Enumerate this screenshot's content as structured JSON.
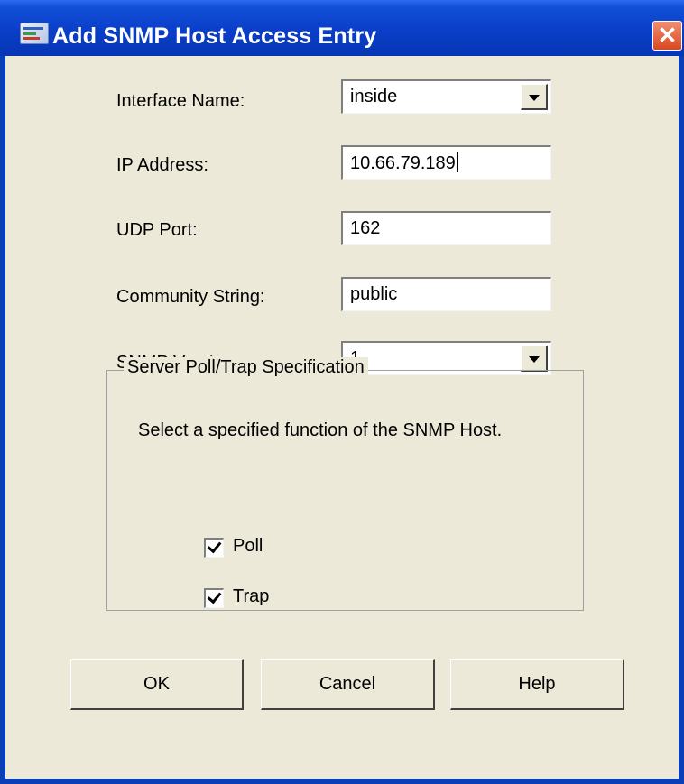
{
  "window": {
    "title": "Add SNMP Host Access Entry",
    "close_glyph": "✕",
    "icon": "app-icon"
  },
  "form": {
    "interface_name": {
      "label": "Interface Name:",
      "value": "inside"
    },
    "ip_address": {
      "label": "IP Address:",
      "value": "10.66.79.189"
    },
    "udp_port": {
      "label": "UDP Port:",
      "value": "162"
    },
    "community_string": {
      "label": "Community String:",
      "value": "public"
    },
    "snmp_version": {
      "label": "SNMP Version:",
      "value": "1"
    }
  },
  "group": {
    "legend": "Server Poll/Trap Specification",
    "description": "Select a specified function of the SNMP Host.",
    "poll": {
      "label": "Poll",
      "checked": true
    },
    "trap": {
      "label": "Trap",
      "checked": true
    }
  },
  "buttons": {
    "ok": "OK",
    "cancel": "Cancel",
    "help": "Help"
  },
  "colors": {
    "titlebar": "#0a3ec8",
    "dialog_bg": "#ece9d8",
    "close_button": "#d9471f"
  }
}
